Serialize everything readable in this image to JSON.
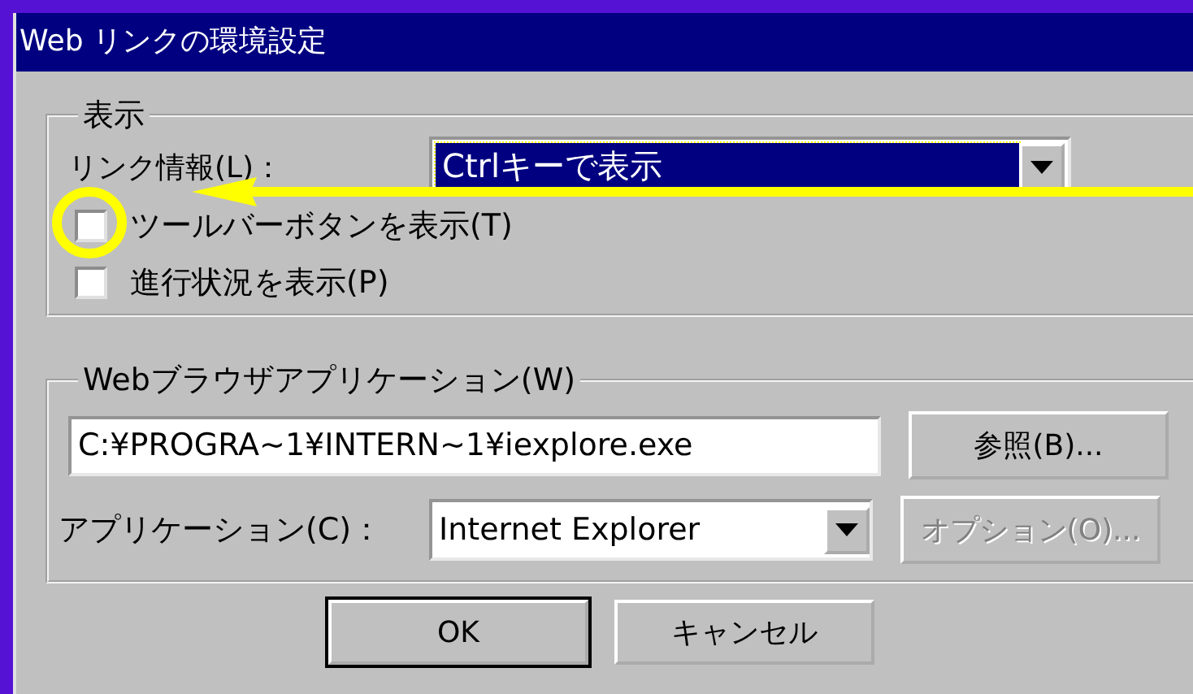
{
  "window": {
    "title": "Web リンクの環境設定"
  },
  "display_group": {
    "title": "表示",
    "link_info_label": "リンク情報(L)：",
    "link_info_value": "Ctrlキーで表示",
    "checkboxes": [
      {
        "label": "ツールバーボタンを表示(T)",
        "checked": false
      },
      {
        "label": "進行状況を表示(P)",
        "checked": false
      }
    ]
  },
  "browser_group": {
    "title": "Webブラウザアプリケーション(W)",
    "path": "C:¥PROGRA~1¥INTERN~1¥iexplore.exe",
    "browse_button": {
      "label": "参照(B)...",
      "disabled": false
    },
    "app_label": "アプリケーション(C)：",
    "app_value": "Internet Explorer",
    "options_button": {
      "label": "オプション(O)...",
      "disabled": true
    }
  },
  "buttons": [
    "OK",
    "キャンセル"
  ]
}
